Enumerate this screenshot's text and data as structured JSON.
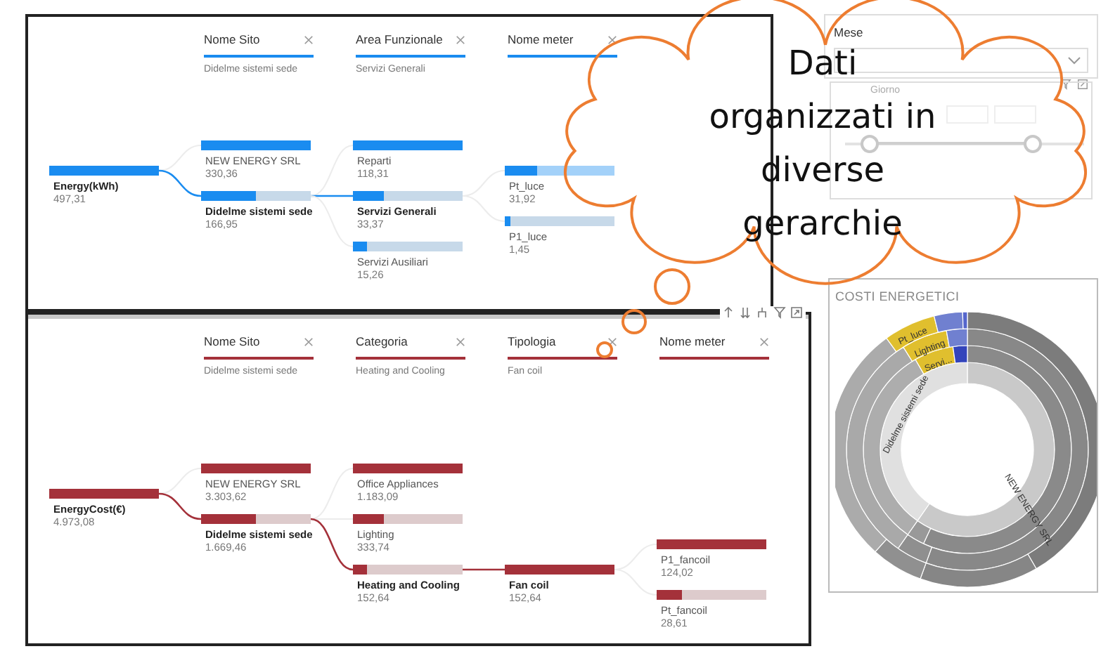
{
  "trees": [
    {
      "color": "#1a8cf0",
      "root": {
        "label": "Energy(kWh)",
        "value": "497,31",
        "level": 1
      },
      "levels": [
        {
          "header": "Nome Sito",
          "filter": "Didelme sistemi sede",
          "nodes": [
            {
              "label": "NEW ENERGY SRL",
              "value": "330,36",
              "level": 1,
              "selected": false
            },
            {
              "label": "Didelme sistemi sede",
              "value": "166,95",
              "level": 0.5,
              "selected": true
            }
          ]
        },
        {
          "header": "Area Funzionale",
          "filter": "Servizi Generali",
          "nodes": [
            {
              "label": "Reparti",
              "value": "118,31",
              "level": 1,
              "selected": false
            },
            {
              "label": "Servizi Generali",
              "value": "33,37",
              "level": 0.28,
              "selected": true
            },
            {
              "label": "Servizi Ausiliari",
              "value": "15,26",
              "level": 0.13,
              "selected": false
            }
          ]
        },
        {
          "header": "Nome meter",
          "nodes": [
            {
              "label": "Pt_luce",
              "value": "31,92",
              "level": 0.3,
              "selected": false,
              "highlighted": true
            },
            {
              "label": "P1_luce",
              "value": "1,45",
              "level": 0.05,
              "selected": false,
              "highlighted": false
            }
          ]
        }
      ]
    },
    {
      "color": "#a4313a",
      "root": {
        "label": "EnergyCost(€)",
        "value": "4.973,08",
        "level": 1
      },
      "levels": [
        {
          "header": "Nome Sito",
          "filter": "Didelme sistemi sede",
          "nodes": [
            {
              "label": "NEW ENERGY SRL",
              "value": "3.303,62",
              "level": 1,
              "selected": false
            },
            {
              "label": "Didelme sistemi sede",
              "value": "1.669,46",
              "level": 0.5,
              "selected": true
            }
          ]
        },
        {
          "header": "Categoria",
          "filter": "Heating and Cooling",
          "nodes": [
            {
              "label": "Office Appliances",
              "value": "1.183,09",
              "level": 1,
              "selected": false
            },
            {
              "label": "Lighting",
              "value": "333,74",
              "level": 0.28,
              "selected": false
            },
            {
              "label": "Heating and Cooling",
              "value": "152,64",
              "level": 0.13,
              "selected": true
            }
          ]
        },
        {
          "header": "Tipologia",
          "filter": "Fan coil",
          "nodes": [
            {
              "label": "Fan coil",
              "value": "152,64",
              "level": 1,
              "selected": true
            }
          ]
        },
        {
          "header": "Nome meter",
          "nodes": [
            {
              "label": "P1_fancoil",
              "value": "124,02",
              "level": 1,
              "selected": false
            },
            {
              "label": "Pt_fancoil",
              "value": "28,61",
              "level": 0.23,
              "selected": false
            }
          ]
        }
      ]
    }
  ],
  "month_slicer": {
    "title": "Mese"
  },
  "day_slicer": {
    "title": "Giorno",
    "thumbs": [
      {
        "level": 0.1
      },
      {
        "level": 0.78
      }
    ]
  },
  "sunburst": {
    "title": "COSTI ENERGETICI",
    "labels": [
      "Pt_luce",
      "Lighting",
      "Servi...",
      "Didelme sistemi sede",
      "NEW ENERGY SRL"
    ]
  },
  "callout": {
    "lines": [
      "Dati",
      "organizzati in",
      "diverse",
      "gerarchie"
    ]
  }
}
